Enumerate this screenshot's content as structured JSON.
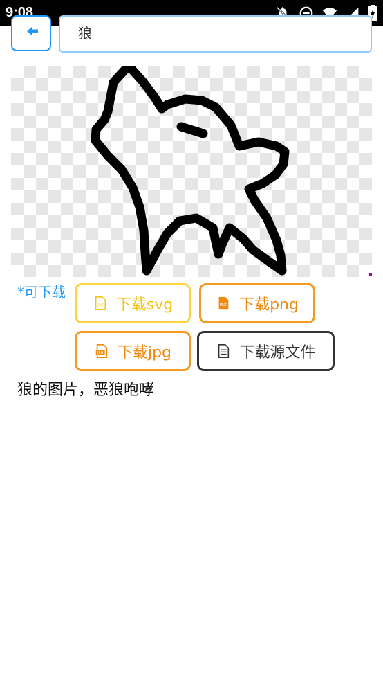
{
  "status_bar": {
    "time": "9:08"
  },
  "search": {
    "value": "狼"
  },
  "download": {
    "label": "*可下载",
    "svg_label": "下载svg",
    "png_label": "下载png",
    "jpg_label": "下载jpg",
    "source_label": "下载源文件",
    "icons": {
      "svg": "svg-file-icon",
      "png": "png-file-icon",
      "jpg": "jpg-file-icon",
      "source": "document-icon"
    }
  },
  "description": "狼的图片，恶狼咆哮",
  "colors": {
    "accent": "#2196f3",
    "svg_button": "#f5c518",
    "png_button": "#f08a0c",
    "jpg_button": "#f08a0c",
    "source_button": "#333333"
  }
}
